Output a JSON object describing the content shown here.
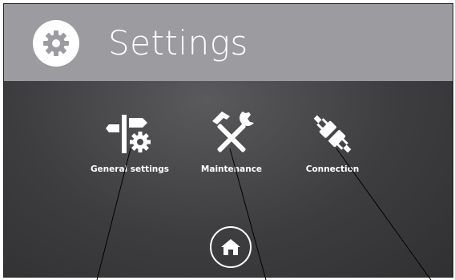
{
  "header": {
    "title": "Settings",
    "icon": "gear-icon"
  },
  "tiles": [
    {
      "label": "General settings",
      "icon": "signpost-gear-icon"
    },
    {
      "label": "Maintenance",
      "icon": "hammer-wrench-icon"
    },
    {
      "label": "Connection",
      "icon": "plug-connector-icon"
    }
  ],
  "home": {
    "icon": "home-icon"
  },
  "colors": {
    "header_bg": "#9c9ca0",
    "body_bg": "#3d3d3f",
    "foreground": "#ffffff"
  }
}
